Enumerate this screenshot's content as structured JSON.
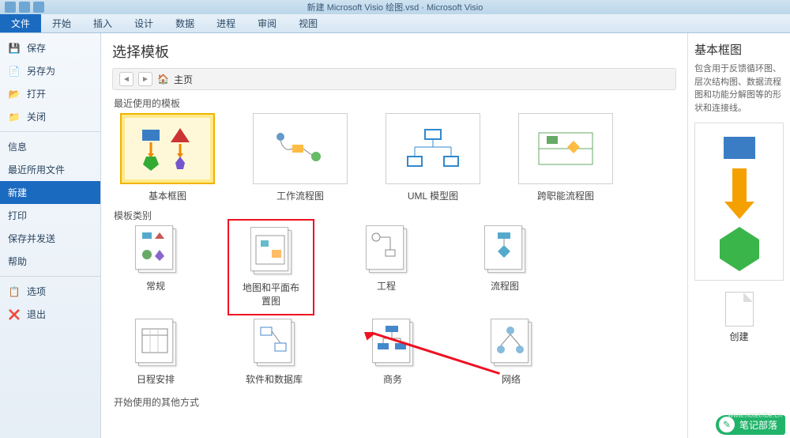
{
  "window": {
    "title": "新建 Microsoft Visio 绘图.vsd · Microsoft Visio"
  },
  "ribbon": {
    "tabs": [
      "文件",
      "开始",
      "插入",
      "设计",
      "数据",
      "进程",
      "审阅",
      "视图"
    ],
    "active": "文件"
  },
  "sidebar": {
    "items": [
      {
        "label": "保存",
        "icon": "save"
      },
      {
        "label": "另存为",
        "icon": "saveas"
      },
      {
        "label": "打开",
        "icon": "open"
      },
      {
        "label": "关闭",
        "icon": "close"
      }
    ],
    "items2": [
      {
        "label": "信息"
      },
      {
        "label": "最近所用文件"
      },
      {
        "label": "新建",
        "active": true
      },
      {
        "label": "打印"
      },
      {
        "label": "保存并发送"
      },
      {
        "label": "帮助"
      }
    ],
    "items3": [
      {
        "label": "选项",
        "icon": "options"
      },
      {
        "label": "退出",
        "icon": "exit"
      }
    ]
  },
  "content": {
    "heading": "选择模板",
    "breadcrumb_home": "主页",
    "recent_label": "最近使用的模板",
    "recent": [
      {
        "label": "基本框图",
        "selected": true
      },
      {
        "label": "工作流程图"
      },
      {
        "label": "UML 模型图"
      },
      {
        "label": "跨职能流程图"
      }
    ],
    "categories_label": "模板类别",
    "categories_row1": [
      {
        "label": "常规"
      },
      {
        "label": "地图和平面布置图",
        "highlight": true
      },
      {
        "label": "工程"
      },
      {
        "label": "流程图"
      }
    ],
    "categories_row2": [
      {
        "label": "日程安排"
      },
      {
        "label": "软件和数据库"
      },
      {
        "label": "商务"
      },
      {
        "label": "网络"
      }
    ],
    "other_label": "开始使用的其他方式"
  },
  "preview": {
    "title": "基本框图",
    "desc": "包含用于反馈循环图、层次结构图、数据流程图和功能分解图等的形状和连接线。",
    "create_label": "创建"
  },
  "watermark": {
    "text": "笔记部落",
    "url": "www.notetribe.cn"
  }
}
